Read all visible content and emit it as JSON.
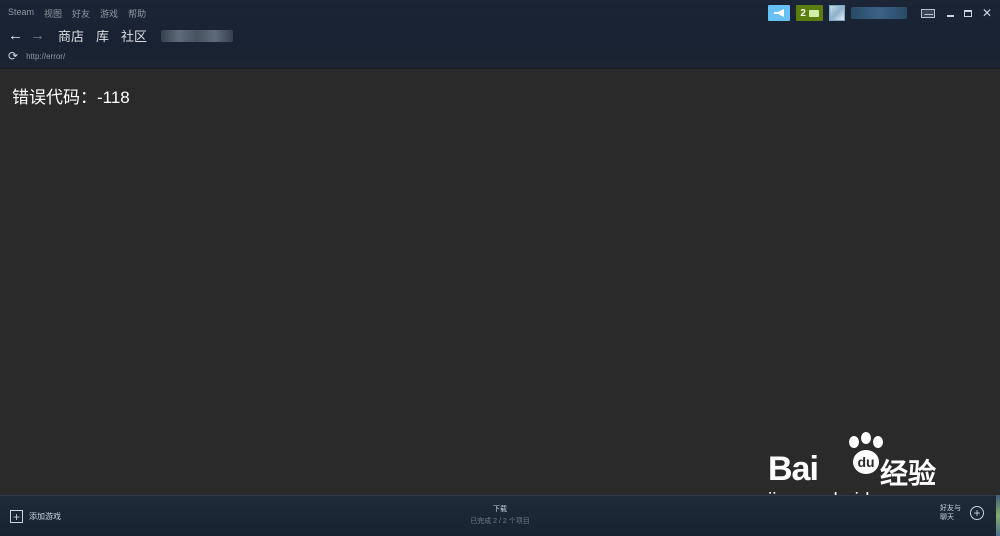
{
  "menubar": {
    "items": [
      "Steam",
      "视图",
      "好友",
      "游戏",
      "帮助"
    ]
  },
  "titlebar": {
    "notification_count": "2"
  },
  "nav": {
    "back_icon": "arrow-left-icon",
    "forward_icon": "arrow-right-icon",
    "tabs": [
      "商店",
      "库",
      "社区"
    ]
  },
  "url": {
    "reload_icon": "reload-icon",
    "address": "http://error/"
  },
  "content": {
    "error_message": "错误代码：-118"
  },
  "bottom": {
    "add_game_label": "添加游戏",
    "download_title": "下载",
    "download_status": "已完成 2 / 2 个项目",
    "friends_label_line1": "好友与",
    "friends_label_line2": "聊天"
  },
  "watermark": {
    "brand_text": "Bai",
    "brand_cn": "经验",
    "url": "jingyan.baidu.com"
  },
  "colors": {
    "accent_blue": "#67c1f5",
    "notif_green": "#5c7e10",
    "content_bg": "#2a2a2a"
  }
}
